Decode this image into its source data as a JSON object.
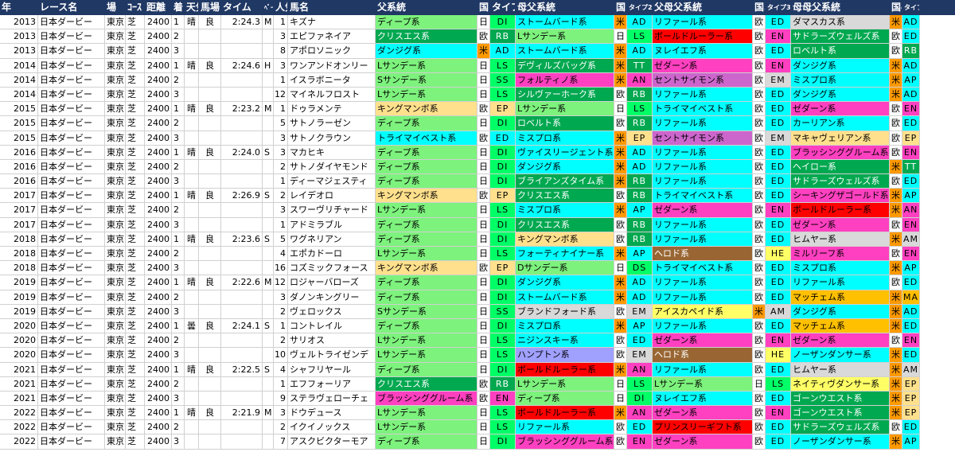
{
  "header": [
    "年",
    "レース名",
    "場",
    "ｺｰｽ",
    "距離",
    "着",
    "天気",
    "馬場",
    "タイム",
    "ﾍﾟｰｽ",
    "人気",
    "馬名",
    "父系統",
    "国",
    "タイプ",
    "母父系統",
    "国2",
    "タイプ2",
    "父母父系統",
    "国3",
    "タイプ3",
    "母母父系統",
    "国4",
    "タイプ4"
  ],
  "colors": {
    "header_bg": "#203864",
    "ディープ系": "#7df27d",
    "Lサンデー系": "#7df27d",
    "Sサンデー系": "#7df27d",
    "Dサンデー系": "#7df27d",
    "クリスエス系": "#00a850",
    "ダンジグ系": "#00ffff",
    "キングマンボ系": "#ffe08c",
    "トライマイベスト系": "#00ffff",
    "ブラッシンググルーム系": "#ff40c0",
    "ストームバード系": "#00ffff",
    "デヴィルズバッグ系": "#00a850",
    "フォルティノ系": "#ff40c0",
    "シルヴァーホーク系": "#00a850",
    "ロベルト系": "#00a850",
    "ミスプロ系": "#00ffff",
    "ヴァイスリージェント系": "#00ffff",
    "ブライアンズタイム系": "#00a850",
    "フォーティナイナー系": "#00ffff",
    "ブランドフォード系": "#d9d9d9",
    "ニジンスキー系": "#00ffff",
    "ハンプトン系": "#a0a0ff",
    "ボールドルーラー系": "#ff0000",
    "エフフォーリア": "#ffffff",
    "リファール系": "#00ffff",
    "ゼダーン系": "#ff40c0",
    "ヌレイエフ系": "#00ffff",
    "セントサイモン系": "#cc66cc",
    "ヘロド系": "#996633",
    "アイスカペイド系": "#ffff66",
    "プリンスリーギフト系": "#ff0000",
    "ダマスカス系": "#d9d9d9",
    "サドラーズウェルズ系": "#00a850",
    "マキャヴェリアン系": "#ffe08c",
    "ヘイロー系": "#00a850",
    "シーキングザゴールド系": "#ff40c0",
    "ミルリーフ系": "#ff40c0",
    "カーリアン系": "#00ffff",
    "ヒムヤー系": "#d9d9d9",
    "マッチェム系": "#ffc000",
    "ネイティヴダンサー系": "#ffff66",
    "ゴーンウエスト系": "#00a850",
    "ノーザンダンサー系": "#00ffff",
    "米": "#ff9900",
    "欧": "#ffffff",
    "日": "#ffffff",
    "type_green": "#00ff66",
    "type_dark": "#00a850",
    "type_red": "#ff0000",
    "type_pink": "#ff40c0"
  },
  "rows": [
    [
      "2013",
      "日本ダービー",
      "東京",
      "芝",
      "2400",
      "1",
      "晴",
      "良",
      "2:24.3",
      "M",
      "1",
      "キズナ",
      "ディープ系",
      "日",
      "DI",
      "ストームバード系",
      "米",
      "AD",
      "リファール系",
      "欧",
      "ED",
      "ダマスカス系",
      "米",
      "AD"
    ],
    [
      "2013",
      "日本ダービー",
      "東京",
      "芝",
      "2400",
      "2",
      "",
      "",
      "",
      "",
      "3",
      "エピファネイア",
      "クリスエス系",
      "欧",
      "RB",
      "Lサンデー系",
      "日",
      "LS",
      "ボールドルーラー系",
      "欧",
      "EN",
      "サドラーズウェルズ系",
      "欧",
      "ED"
    ],
    [
      "2013",
      "日本ダービー",
      "東京",
      "芝",
      "2400",
      "3",
      "",
      "",
      "",
      "",
      "8",
      "アポロソニック",
      "ダンジグ系",
      "米",
      "AD",
      "ストームバード系",
      "米",
      "AD",
      "ヌレイエフ系",
      "欧",
      "ED",
      "ロベルト系",
      "欧",
      "RB"
    ],
    [
      "2014",
      "日本ダービー",
      "東京",
      "芝",
      "2400",
      "1",
      "晴",
      "良",
      "2:24.6",
      "H",
      "3",
      "ワンアンドオンリー",
      "Lサンデー系",
      "日",
      "LS",
      "デヴィルズバッグ系",
      "米",
      "TT",
      "ゼダーン系",
      "欧",
      "EN",
      "ダンジグ系",
      "米",
      "AD"
    ],
    [
      "2014",
      "日本ダービー",
      "東京",
      "芝",
      "2400",
      "2",
      "",
      "",
      "",
      "",
      "1",
      "イスラボニータ",
      "Sサンデー系",
      "日",
      "SS",
      "フォルティノ系",
      "米",
      "AN",
      "セントサイモン系",
      "欧",
      "EM",
      "ミスプロ系",
      "米",
      "AP"
    ],
    [
      "2014",
      "日本ダービー",
      "東京",
      "芝",
      "2400",
      "3",
      "",
      "",
      "",
      "",
      "12",
      "マイネルフロスト",
      "Lサンデー系",
      "日",
      "LS",
      "シルヴァーホーク系",
      "欧",
      "RB",
      "リファール系",
      "欧",
      "ED",
      "ダンジグ系",
      "米",
      "AD"
    ],
    [
      "2015",
      "日本ダービー",
      "東京",
      "芝",
      "2400",
      "1",
      "晴",
      "良",
      "2:23.2",
      "M",
      "1",
      "ドゥラメンテ",
      "キングマンボ系",
      "欧",
      "EP",
      "Lサンデー系",
      "日",
      "LS",
      "トライマイベスト系",
      "欧",
      "ED",
      "ゼダーン系",
      "欧",
      "EN"
    ],
    [
      "2015",
      "日本ダービー",
      "東京",
      "芝",
      "2400",
      "2",
      "",
      "",
      "",
      "",
      "5",
      "サトノラーゼン",
      "ディープ系",
      "日",
      "DI",
      "ロベルト系",
      "欧",
      "RB",
      "リファール系",
      "欧",
      "ED",
      "カーリアン系",
      "欧",
      "ED"
    ],
    [
      "2015",
      "日本ダービー",
      "東京",
      "芝",
      "2400",
      "3",
      "",
      "",
      "",
      "",
      "3",
      "サトノクラウン",
      "トライマイベスト系",
      "欧",
      "ED",
      "ミスプロ系",
      "米",
      "EP",
      "セントサイモン系",
      "欧",
      "EM",
      "マキャヴェリアン系",
      "欧",
      "EP"
    ],
    [
      "2016",
      "日本ダービー",
      "東京",
      "芝",
      "2400",
      "1",
      "晴",
      "良",
      "2:24.0",
      "S",
      "3",
      "マカヒキ",
      "ディープ系",
      "日",
      "DI",
      "ヴァイスリージェント系",
      "米",
      "AD",
      "リファール系",
      "欧",
      "ED",
      "ブラッシンググルーム系",
      "欧",
      "EN"
    ],
    [
      "2016",
      "日本ダービー",
      "東京",
      "芝",
      "2400",
      "2",
      "",
      "",
      "",
      "",
      "2",
      "サトノダイヤモンド",
      "ディープ系",
      "日",
      "DI",
      "ダンジグ系",
      "米",
      "AD",
      "リファール系",
      "欧",
      "ED",
      "ヘイロー系",
      "米",
      "TT"
    ],
    [
      "2016",
      "日本ダービー",
      "東京",
      "芝",
      "2400",
      "3",
      "",
      "",
      "",
      "",
      "1",
      "ディーマジェスティ",
      "ディープ系",
      "日",
      "DI",
      "ブライアンズタイム系",
      "米",
      "RB",
      "リファール系",
      "欧",
      "ED",
      "サドラーズウェルズ系",
      "欧",
      "ED"
    ],
    [
      "2017",
      "日本ダービー",
      "東京",
      "芝",
      "2400",
      "1",
      "晴",
      "良",
      "2:26.9",
      "S",
      "2",
      "レイデオロ",
      "キングマンボ系",
      "欧",
      "EP",
      "クリスエス系",
      "欧",
      "RB",
      "トライマイベスト系",
      "欧",
      "ED",
      "シーキングザゴールド系",
      "米",
      "AP"
    ],
    [
      "2017",
      "日本ダービー",
      "東京",
      "芝",
      "2400",
      "2",
      "",
      "",
      "",
      "",
      "3",
      "スワーヴリチャード",
      "Lサンデー系",
      "日",
      "LS",
      "ミスプロ系",
      "米",
      "AP",
      "ゼダーン系",
      "欧",
      "EN",
      "ボールドルーラー系",
      "米",
      "AN"
    ],
    [
      "2017",
      "日本ダービー",
      "東京",
      "芝",
      "2400",
      "3",
      "",
      "",
      "",
      "",
      "1",
      "アドミラブル",
      "ディープ系",
      "日",
      "DI",
      "クリスエス系",
      "欧",
      "RB",
      "リファール系",
      "欧",
      "ED",
      "ゼダーン系",
      "欧",
      "EN"
    ],
    [
      "2018",
      "日本ダービー",
      "東京",
      "芝",
      "2400",
      "1",
      "晴",
      "良",
      "2:23.6",
      "S",
      "5",
      "ワグネリアン",
      "ディープ系",
      "日",
      "DI",
      "キングマンボ系",
      "欧",
      "RB",
      "リファール系",
      "欧",
      "ED",
      "ヒムヤー系",
      "米",
      "AM"
    ],
    [
      "2018",
      "日本ダービー",
      "東京",
      "芝",
      "2400",
      "2",
      "",
      "",
      "",
      "",
      "4",
      "エポカドーロ",
      "Lサンデー系",
      "日",
      "LS",
      "フォーティナイナー系",
      "米",
      "AP",
      "ヘロド系",
      "欧",
      "HE",
      "ミルリーフ系",
      "欧",
      "EN"
    ],
    [
      "2018",
      "日本ダービー",
      "東京",
      "芝",
      "2400",
      "3",
      "",
      "",
      "",
      "",
      "16",
      "コズミックフォース",
      "キングマンボ系",
      "欧",
      "EP",
      "Dサンデー系",
      "日",
      "DS",
      "トライマイベスト系",
      "欧",
      "ED",
      "ミスプロ系",
      "米",
      "AP"
    ],
    [
      "2019",
      "日本ダービー",
      "東京",
      "芝",
      "2400",
      "1",
      "晴",
      "良",
      "2:22.6",
      "M",
      "12",
      "ロジャーバローズ",
      "ディープ系",
      "日",
      "DI",
      "ダンジグ系",
      "米",
      "AD",
      "リファール系",
      "欧",
      "ED",
      "リファール系",
      "欧",
      "ED"
    ],
    [
      "2019",
      "日本ダービー",
      "東京",
      "芝",
      "2400",
      "2",
      "",
      "",
      "",
      "",
      "3",
      "ダノンキングリー",
      "ディープ系",
      "日",
      "DI",
      "ストームバード系",
      "米",
      "AD",
      "リファール系",
      "欧",
      "ED",
      "マッチェム系",
      "米",
      "MA"
    ],
    [
      "2019",
      "日本ダービー",
      "東京",
      "芝",
      "2400",
      "3",
      "",
      "",
      "",
      "",
      "2",
      "ヴェロックス",
      "Sサンデー系",
      "日",
      "SS",
      "ブランドフォード系",
      "欧",
      "EM",
      "アイスカペイド系",
      "米",
      "AM",
      "ダンジグ系",
      "米",
      "AD"
    ],
    [
      "2020",
      "日本ダービー",
      "東京",
      "芝",
      "2400",
      "1",
      "曇",
      "良",
      "2:24.1",
      "S",
      "1",
      "コントレイル",
      "ディープ系",
      "日",
      "DI",
      "ミスプロ系",
      "米",
      "AP",
      "リファール系",
      "欧",
      "ED",
      "マッチェム系",
      "米",
      "ED"
    ],
    [
      "2020",
      "日本ダービー",
      "東京",
      "芝",
      "2400",
      "2",
      "",
      "",
      "",
      "",
      "2",
      "サリオス",
      "Lサンデー系",
      "日",
      "LS",
      "ニジンスキー系",
      "欧",
      "ED",
      "ゼダーン系",
      "欧",
      "EN",
      "ゼダーン系",
      "欧",
      "EN"
    ],
    [
      "2020",
      "日本ダービー",
      "東京",
      "芝",
      "2400",
      "3",
      "",
      "",
      "",
      "",
      "10",
      "ヴェルトライゼンデ",
      "Lサンデー系",
      "日",
      "LS",
      "ハンプトン系",
      "欧",
      "EM",
      "ヘロド系",
      "欧",
      "HE",
      "ノーザンダンサー系",
      "米",
      "ED"
    ],
    [
      "2021",
      "日本ダービー",
      "東京",
      "芝",
      "2400",
      "1",
      "晴",
      "良",
      "2:22.5",
      "S",
      "4",
      "シャフリヤール",
      "ディープ系",
      "日",
      "DI",
      "ボールドルーラー系",
      "米",
      "AN",
      "リファール系",
      "欧",
      "ED",
      "ヒムヤー系",
      "米",
      "AM"
    ],
    [
      "2021",
      "日本ダービー",
      "東京",
      "芝",
      "2400",
      "2",
      "",
      "",
      "",
      "",
      "1",
      "エフフォーリア",
      "クリスエス系",
      "欧",
      "RB",
      "Lサンデー系",
      "日",
      "LS",
      "Lサンデー系",
      "日",
      "LS",
      "ネイティヴダンサー系",
      "米",
      "EP"
    ],
    [
      "2021",
      "日本ダービー",
      "東京",
      "芝",
      "2400",
      "3",
      "",
      "",
      "",
      "",
      "9",
      "ステラヴェローチェ",
      "ブラッシンググルーム系",
      "欧",
      "EN",
      "ディープ系",
      "日",
      "DI",
      "ヌレイエフ系",
      "欧",
      "ED",
      "ゴーンウエスト系",
      "米",
      "EP"
    ],
    [
      "2022",
      "日本ダービー",
      "東京",
      "芝",
      "2400",
      "1",
      "晴",
      "良",
      "2:21.9",
      "M",
      "3",
      "ドウデュース",
      "Lサンデー系",
      "日",
      "LS",
      "ボールドルーラー系",
      "米",
      "AN",
      "ゼダーン系",
      "欧",
      "EN",
      "ゴーンウエスト系",
      "米",
      "EP"
    ],
    [
      "2022",
      "日本ダービー",
      "東京",
      "芝",
      "2400",
      "2",
      "",
      "",
      "",
      "",
      "2",
      "イクイノックス",
      "Lサンデー系",
      "日",
      "LS",
      "リファール系",
      "欧",
      "ED",
      "プリンスリーギフト系",
      "欧",
      "ED",
      "サドラーズウェルズ系",
      "欧",
      "ED"
    ],
    [
      "2022",
      "日本ダービー",
      "東京",
      "芝",
      "2400",
      "3",
      "",
      "",
      "",
      "",
      "7",
      "アスクビクターモア",
      "ディープ系",
      "日",
      "DI",
      "ブラッシンググルーム系",
      "欧",
      "EN",
      "ゼダーン系",
      "欧",
      "ED",
      "ノーザンダンサー系",
      "米",
      "AP"
    ]
  ]
}
